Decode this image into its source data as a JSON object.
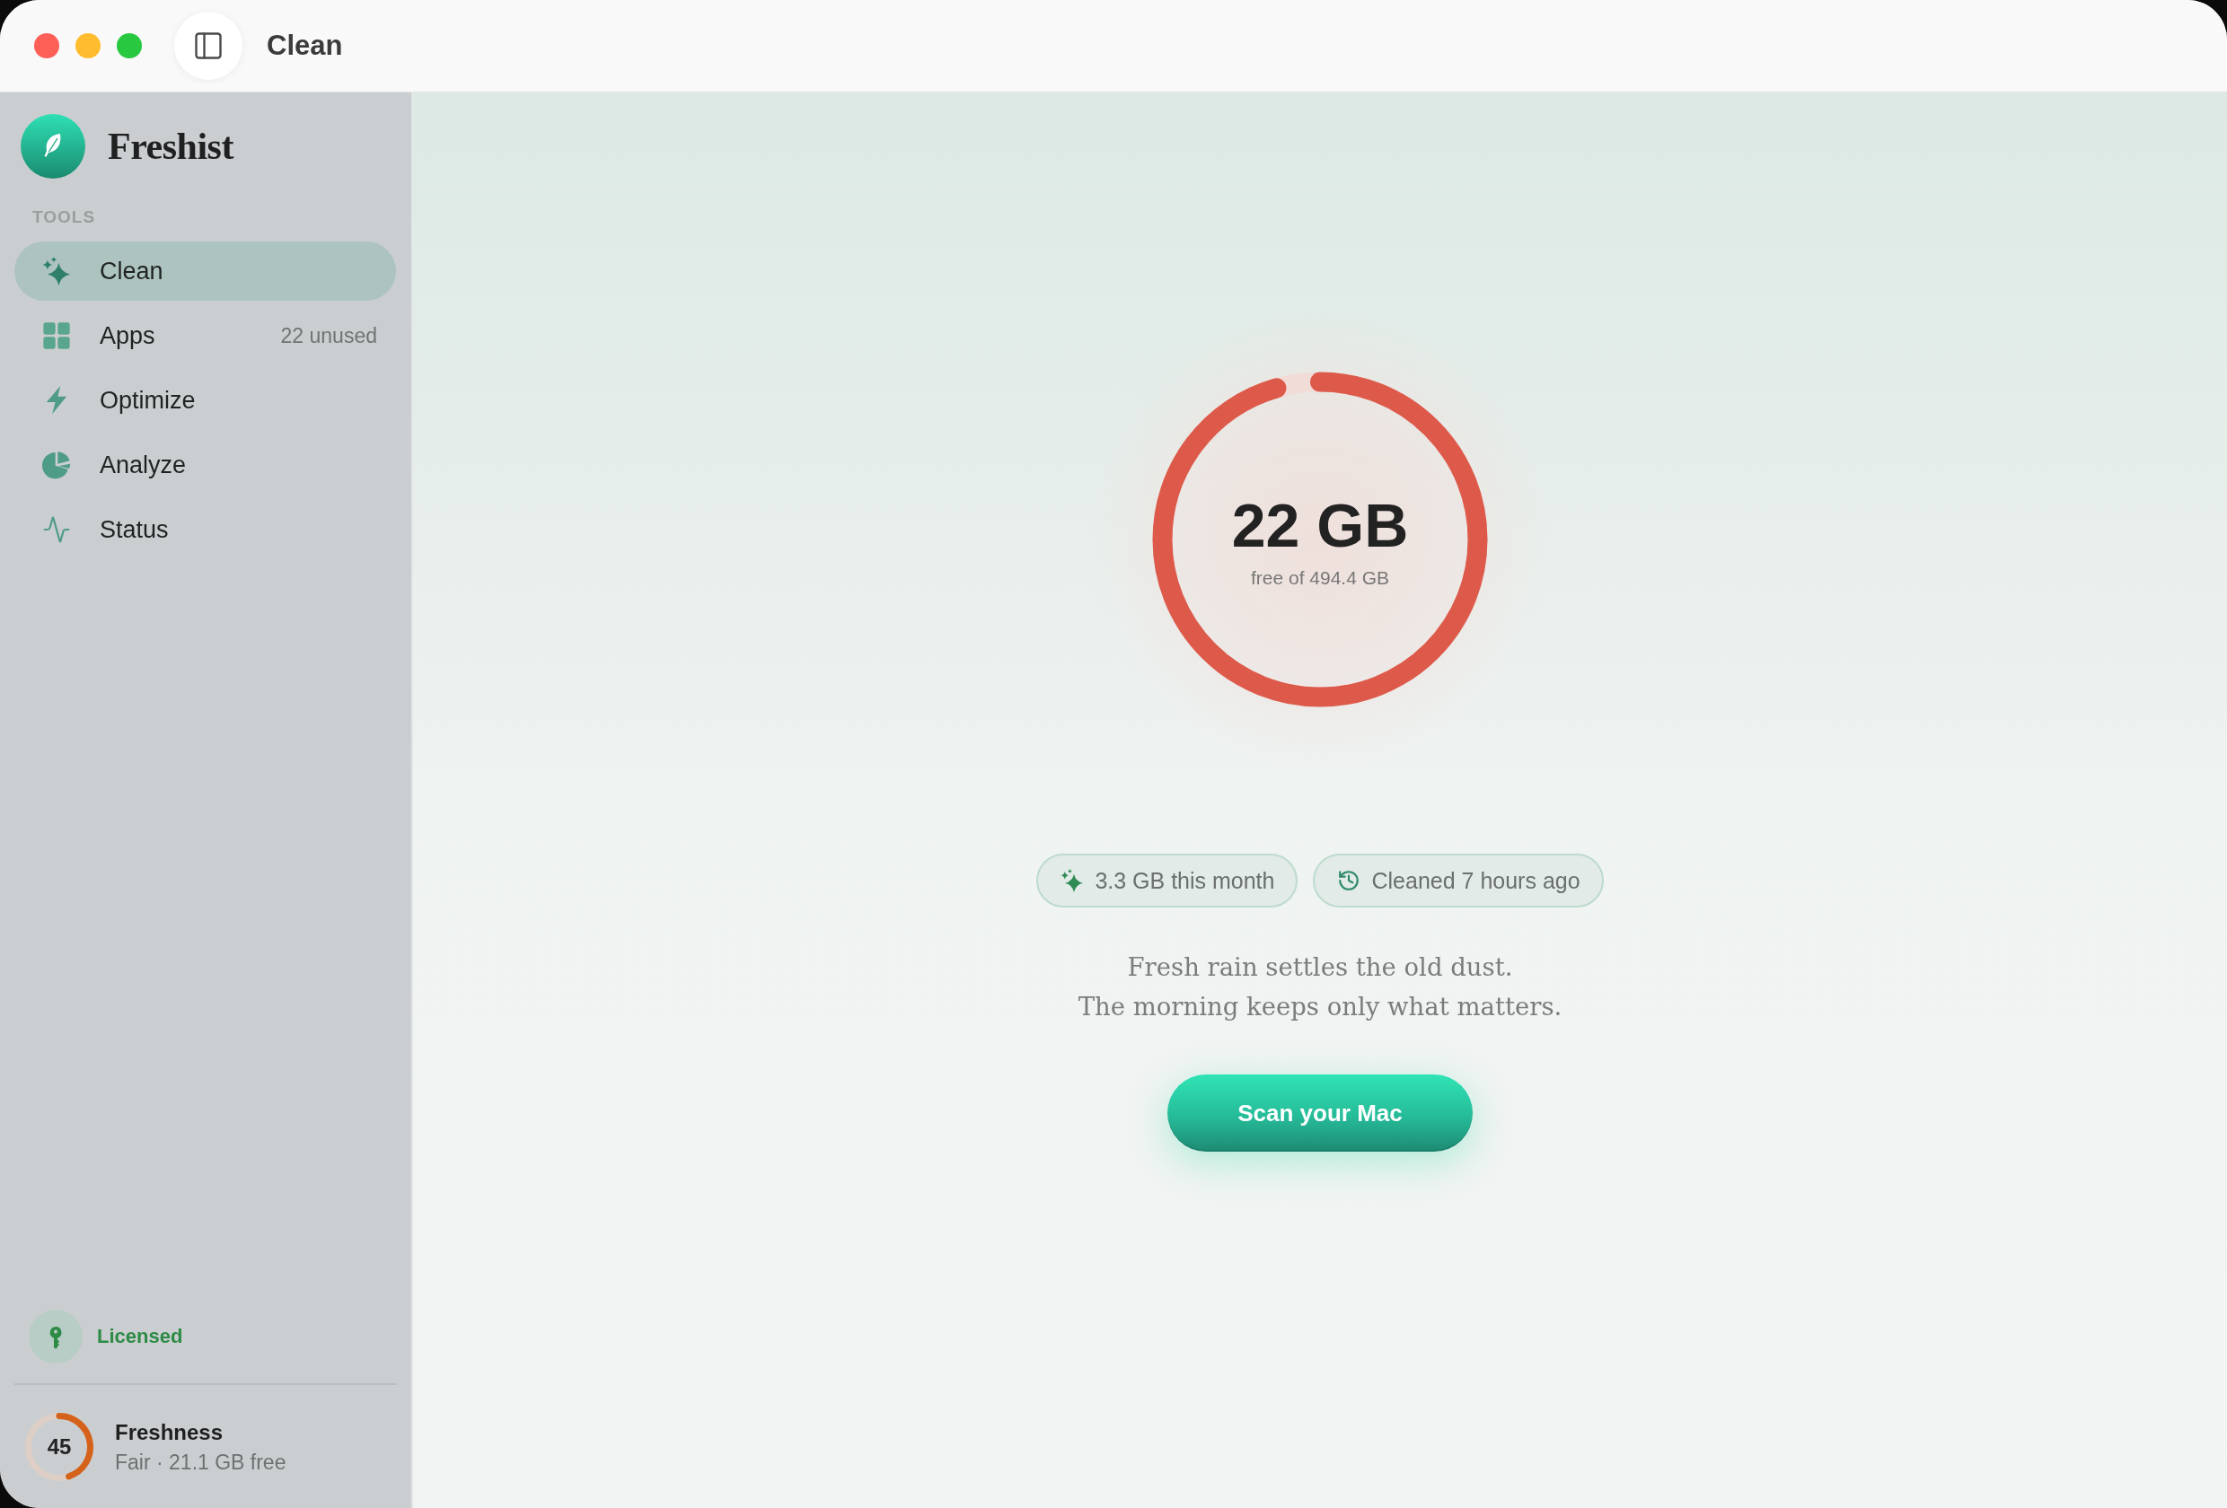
{
  "window": {
    "title": "Clean"
  },
  "sidebar": {
    "app_name": "Freshist",
    "section_label": "TOOLS",
    "items": [
      {
        "label": "Clean",
        "selected": true
      },
      {
        "label": "Apps",
        "selected": false,
        "badge": "22 unused"
      },
      {
        "label": "Optimize",
        "selected": false
      },
      {
        "label": "Analyze",
        "selected": false
      },
      {
        "label": "Status",
        "selected": false
      }
    ],
    "license": {
      "label": "Licensed"
    },
    "freshness": {
      "score": "45",
      "level": 0.45,
      "title": "Freshness",
      "detail": "Fair · 21.1 GB free"
    }
  },
  "main": {
    "disk": {
      "free": "22 GB",
      "caption": "free of 494.4 GB",
      "level": 0.955
    },
    "chips": [
      {
        "label": "3.3 GB this month"
      },
      {
        "label": "Cleaned 7 hours ago"
      }
    ],
    "poem": [
      "Fresh rain settles the old dust.",
      "The morning keeps only what matters."
    ],
    "button": "Scan your Mac"
  }
}
